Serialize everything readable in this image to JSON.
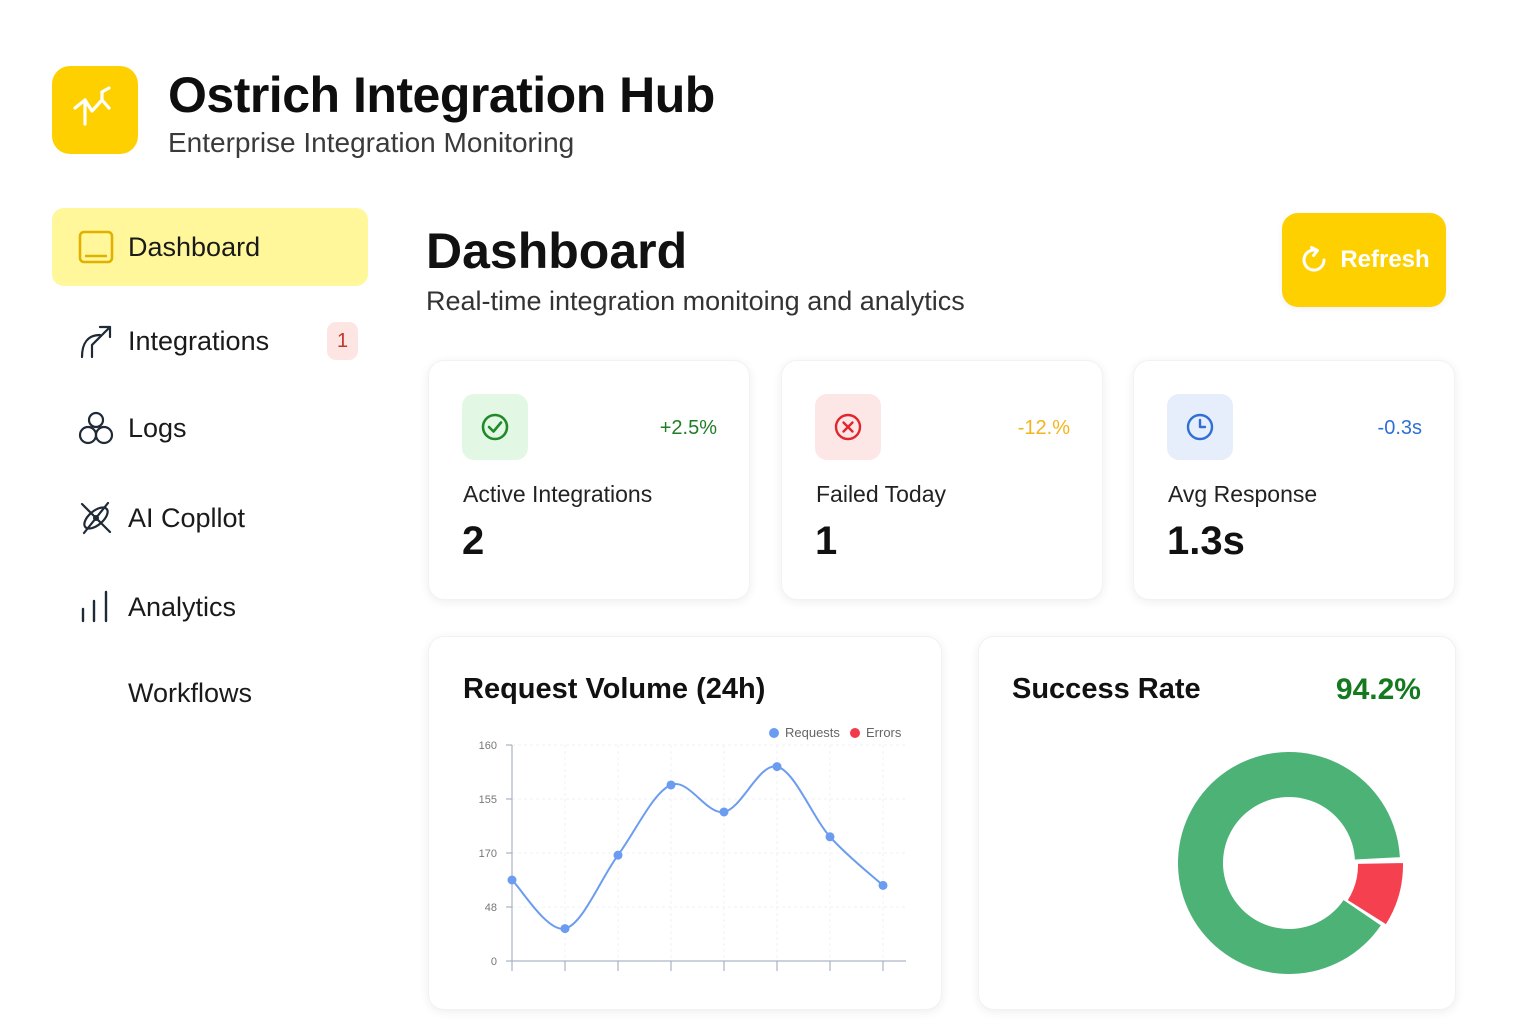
{
  "app": {
    "title": "Ostrich Integration Hub",
    "subtitle": "Enterprise Integration Monitoring",
    "brand_color": "#FFD000"
  },
  "sidebar": {
    "items": [
      {
        "label": "Dashboard",
        "icon": "dashboard-icon",
        "active": true
      },
      {
        "label": "Integrations",
        "icon": "integrations-arrow-icon",
        "badge": "1"
      },
      {
        "label": "Logs",
        "icon": "logs-icon"
      },
      {
        "label": "AI Copllot",
        "icon": "ai-copilot-icon"
      },
      {
        "label": "Analytics",
        "icon": "analytics-bars-icon"
      },
      {
        "label": "Workflows"
      }
    ]
  },
  "header": {
    "title": "Dashboard",
    "subtitle": "Real-time integration  monitoing and analytics",
    "refresh_label": "Refresh"
  },
  "stats": [
    {
      "label": "Active Integrations",
      "value": "2",
      "change": "+2.5%",
      "change_color": "#1e7e26",
      "icon": "check-circle-icon",
      "icon_bg": "#E3F8E4",
      "icon_color": "#1f8a2a"
    },
    {
      "label": "Failed Today",
      "value": "1",
      "change": "-12.%",
      "change_color": "#F2B51C",
      "icon": "x-circle-icon",
      "icon_bg": "#FDE6E6",
      "icon_color": "#e0262e"
    },
    {
      "label": "Avg Response",
      "value": "1.3s",
      "change": "-0.3s",
      "change_color": "#2f6fd6",
      "icon": "clock-icon",
      "icon_bg": "#E6EEFB",
      "icon_color": "#2f6fd6"
    }
  ],
  "request_chart": {
    "title": "Request Volume (24h)",
    "legend": [
      {
        "name": "Requests",
        "color": "#6b9cf0"
      },
      {
        "name": "Errors",
        "color": "#f23b4a"
      }
    ]
  },
  "success": {
    "title": "Success Rate",
    "value": "94.2%",
    "success_color": "#4CB275",
    "error_color": "#F5404F"
  },
  "chart_data": [
    {
      "type": "line",
      "title": "Request Volume (24h)",
      "y_tick_labels": [
        "160",
        "155",
        "170",
        "48",
        "0"
      ],
      "series": [
        {
          "name": "Requests",
          "color": "#6b9cf0",
          "values": [
            75,
            30,
            98,
            163,
            138,
            180,
            115,
            70
          ]
        },
        {
          "name": "Errors",
          "color": "#f23b4a",
          "values": []
        }
      ],
      "grid": true,
      "legend_position": "top-right"
    },
    {
      "type": "pie",
      "title": "Success Rate",
      "slices": [
        {
          "label": "Success",
          "value": 94.2,
          "color": "#4CB275"
        },
        {
          "label": "Errors",
          "value": 5.8,
          "color": "#F5404F"
        }
      ],
      "donut": true
    }
  ]
}
